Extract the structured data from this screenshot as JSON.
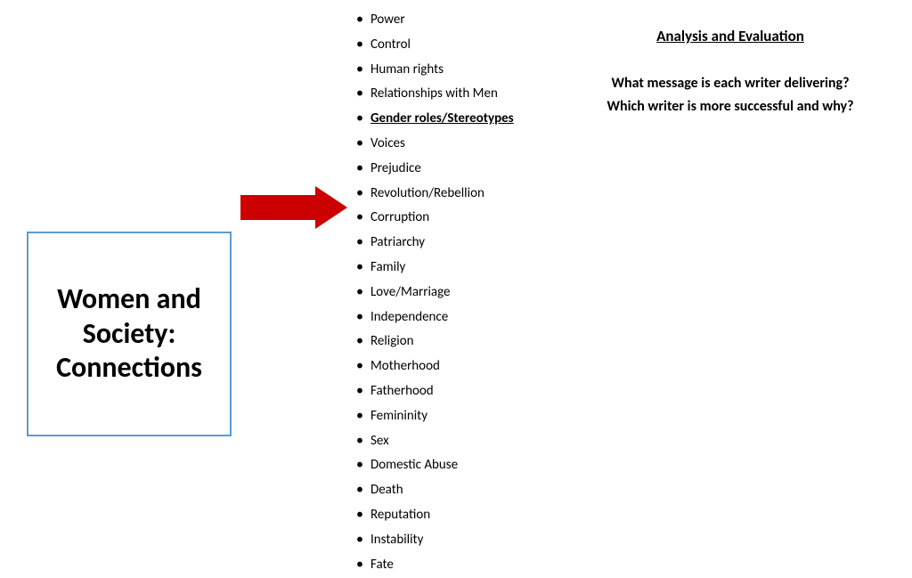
{
  "titleBox": {
    "line1": "Women and",
    "line2": "Society:",
    "line3": "Connections"
  },
  "topics": [
    {
      "text": "Power",
      "bold": false
    },
    {
      "text": "Control",
      "bold": false
    },
    {
      "text": "Human rights",
      "bold": false
    },
    {
      "text": "Relationships with Men",
      "bold": false
    },
    {
      "text": "Gender roles/Stereotypes",
      "bold": true
    },
    {
      "text": "Voices",
      "bold": false
    },
    {
      "text": "Prejudice",
      "bold": false
    },
    {
      "text": "Revolution/Rebellion",
      "bold": false
    },
    {
      "text": "Corruption",
      "bold": false
    },
    {
      "text": "Patriarchy",
      "bold": false
    },
    {
      "text": "Family",
      "bold": false
    },
    {
      "text": "Love/Marriage",
      "bold": false
    },
    {
      "text": "Independence",
      "bold": false
    },
    {
      "text": "Religion",
      "bold": false
    },
    {
      "text": "Motherhood",
      "bold": false
    },
    {
      "text": "Fatherhood",
      "bold": false
    },
    {
      "text": "Femininity",
      "bold": false
    },
    {
      "text": "Sex",
      "bold": false
    },
    {
      "text": "Domestic Abuse",
      "bold": false
    },
    {
      "text": "Death",
      "bold": false
    },
    {
      "text": "Reputation",
      "bold": false
    },
    {
      "text": "Instability",
      "bold": false
    },
    {
      "text": "Fate",
      "bold": false
    }
  ],
  "rightPanel": {
    "heading": "Analysis and Evaluation",
    "question1": "What message is each writer delivering?",
    "question2": "Which writer is more successful and why?"
  }
}
